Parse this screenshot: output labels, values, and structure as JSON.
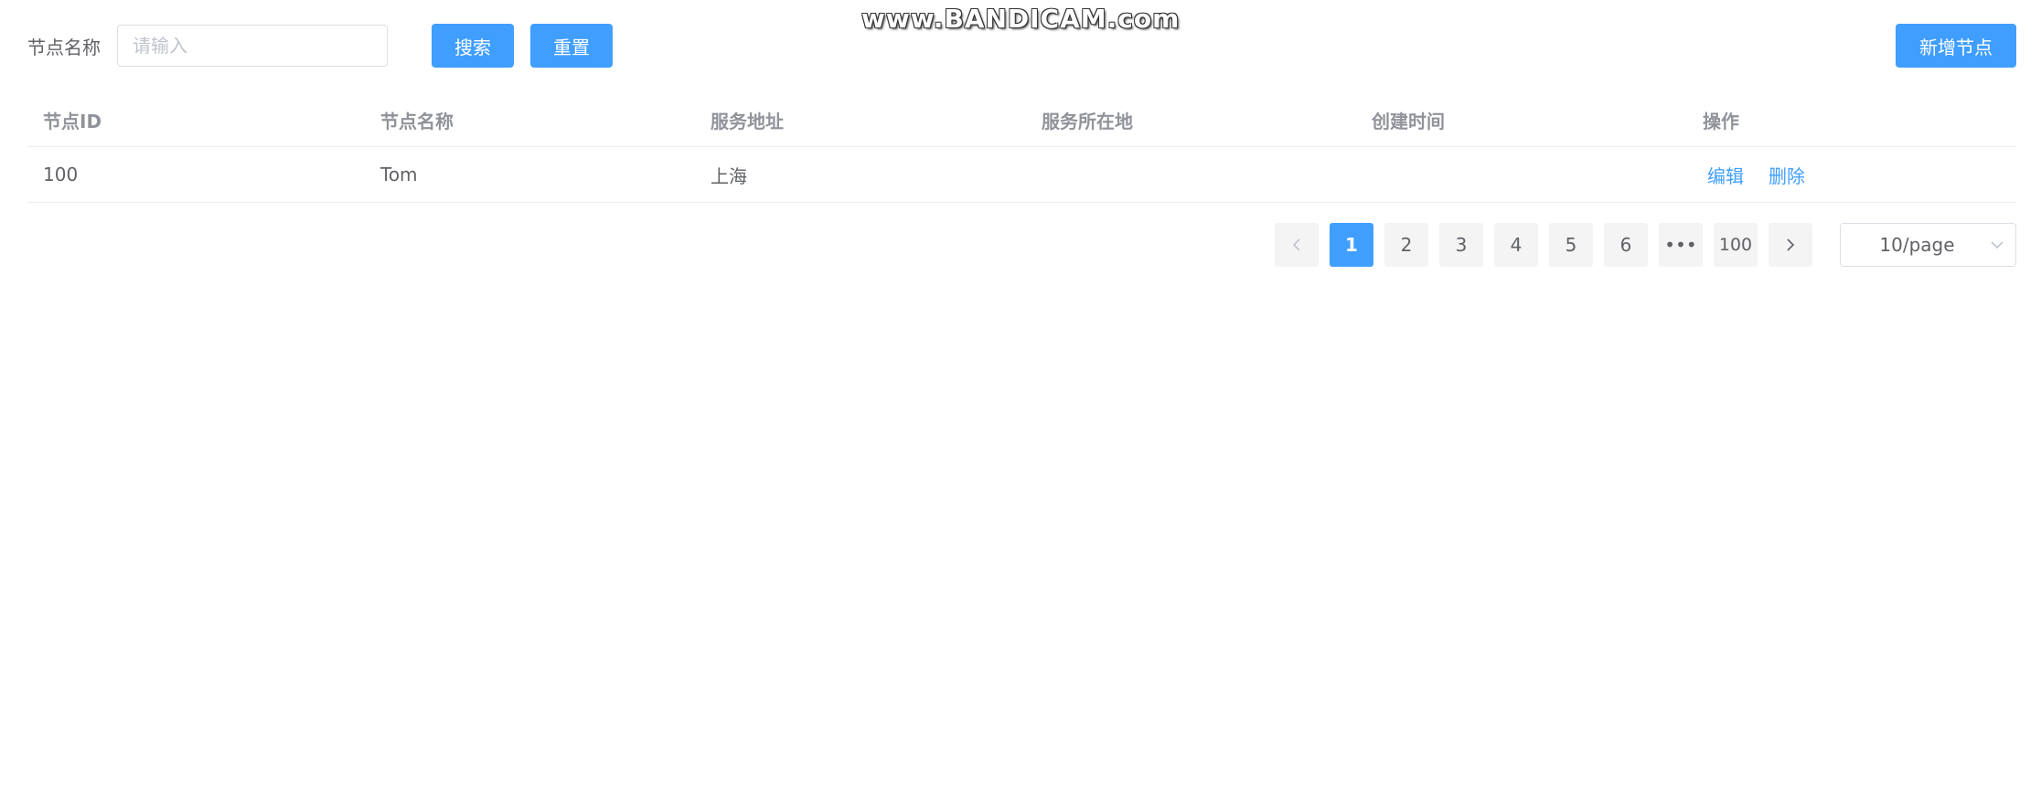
{
  "watermark": "www.BANDICAM.com",
  "toolbar": {
    "filter_label": "节点名称",
    "search_placeholder": "请输入",
    "search_value": "",
    "search_button": "搜索",
    "reset_button": "重置",
    "add_button": "新增节点"
  },
  "table": {
    "columns": [
      "节点ID",
      "节点名称",
      "服务地址",
      "服务所在地",
      "创建时间",
      "操作"
    ],
    "rows": [
      {
        "id": "100",
        "name": "Tom",
        "address": "上海",
        "location": "",
        "created": "",
        "actions": {
          "edit": "编辑",
          "delete": "删除"
        }
      }
    ]
  },
  "pagination": {
    "pages": [
      "1",
      "2",
      "3",
      "4",
      "5",
      "6",
      "•••",
      "100"
    ],
    "current_page": "1",
    "page_size": "10/page"
  },
  "colors": {
    "primary": "#409eff",
    "header_text": "#909399",
    "body_text": "#606266"
  },
  "icons": {
    "prev": "chevron-left-icon",
    "next": "chevron-right-icon",
    "dropdown": "chevron-down-icon"
  }
}
